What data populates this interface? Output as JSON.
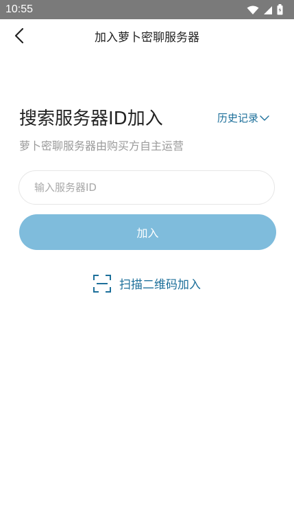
{
  "status_bar": {
    "time": "10:55"
  },
  "nav": {
    "title": "加入萝卜密聊服务器"
  },
  "main": {
    "heading": "搜索服务器ID加入",
    "history_label": "历史记录",
    "subtitle": "萝卜密聊服务器由购买方自主运营",
    "input_placeholder": "输入服务器ID",
    "input_value": "",
    "join_label": "加入",
    "scan_label": "扫描二维码加入"
  },
  "colors": {
    "accent": "#1c6f9a",
    "button": "#7fbcdc",
    "status_bar": "#7a7a7a"
  },
  "icons": {
    "back": "back-arrow-icon",
    "history": "chevron-down-icon",
    "scan": "scan-qr-icon",
    "wifi": "wifi-icon",
    "signal": "signal-icon",
    "battery": "battery-icon"
  }
}
